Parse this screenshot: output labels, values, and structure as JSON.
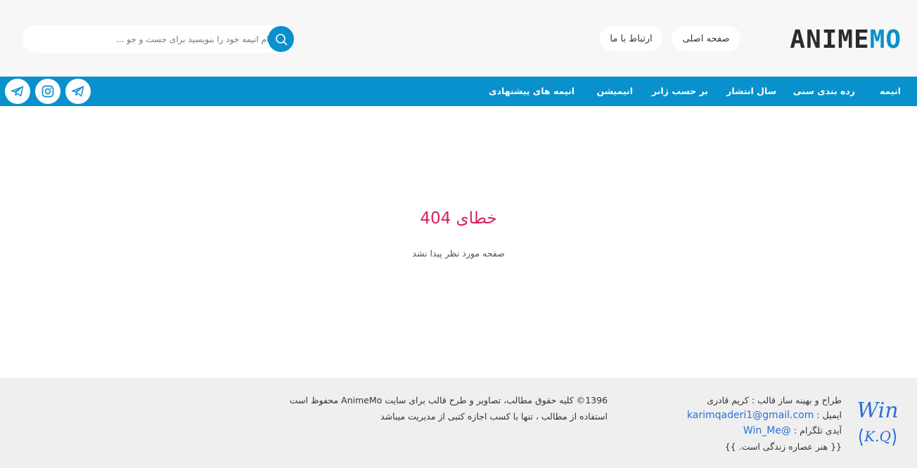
{
  "header": {
    "logo_dark": "ANIME",
    "logo_blue": "MO",
    "home_label": "صفحه اصلی",
    "contact_label": "ارتباط با ما",
    "search": {
      "placeholder": "نام انیمه خود را بنویسید برای جست و جو ..."
    },
    "search_icon": "search-icon"
  },
  "nav": {
    "items": [
      {
        "label": "انیمه"
      },
      {
        "label": "رده بندی سنی"
      },
      {
        "label": "سال انتشار"
      },
      {
        "label": "بر حسب ژانر"
      },
      {
        "label": "انیمیشن"
      },
      {
        "label": "انیمه های پیشنهادی"
      }
    ],
    "social": [
      {
        "icon": "telegram-icon"
      },
      {
        "icon": "instagram-icon"
      },
      {
        "icon": "telegram-icon"
      }
    ]
  },
  "main": {
    "error_title": "خطای 404",
    "error_subtitle": "صفحه مورد نظر پیدا نشد"
  },
  "footer": {
    "designer_label": "طراح و بهینه ساز قالب : کریم قادری",
    "email_label": "ایمیل :",
    "email": "karimqaderi1@gmail.com",
    "telegram_label": "آیدی تلگرام :",
    "telegram_id": "@Win_Me",
    "motto": "{{ هنر عصاره زندگی است. }}",
    "copyright_line1": "1396© کلیه حقوق مطالب، تصاویر و طرح قالب برای سایت AnimeMo محفوظ است",
    "copyright_line2": "استفاده از مطالب ، تنها با کسب اجازه کتبی از مدیریت میباشد",
    "logo_line1": "Win",
    "logo_line2": "K.Q"
  },
  "colors": {
    "brand_blue": "#0891cc",
    "error_red": "#d6205f",
    "link_blue": "#2a6fd6"
  }
}
